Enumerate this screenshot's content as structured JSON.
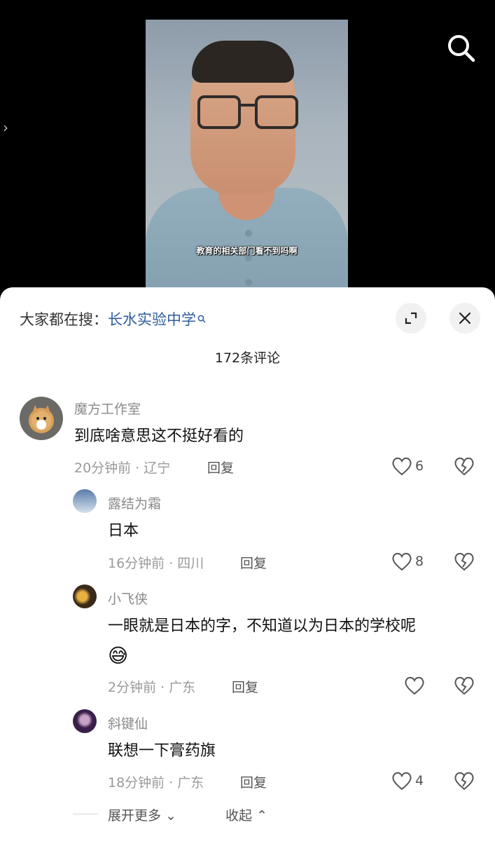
{
  "video": {
    "subtitle": "教育的相关部门看不到吗啊"
  },
  "sheet": {
    "hot_search_prefix": "大家都在搜：",
    "hot_search_keyword": "长水实验中学",
    "comment_count": "172条评论",
    "comments": [
      {
        "name": "魔方工作室",
        "text": "到底啥意思这不挺好看的",
        "time_loc": "20分钟前 · 辽宁",
        "reply": "回复",
        "likes": "6"
      },
      {
        "name": "露结为霜",
        "text": "日本",
        "time_loc": "16分钟前 · 四川",
        "reply": "回复",
        "likes": "8"
      },
      {
        "name": "小飞侠",
        "text": "一眼就是日本的字，不知道以为日本的学校呢",
        "emoji": "😅",
        "time_loc": "2分钟前 · 广东",
        "reply": "回复",
        "likes": ""
      },
      {
        "name": "斜键仙",
        "text": "联想一下膏药旗",
        "time_loc": "18分钟前 · 广东",
        "reply": "回复",
        "likes": "4"
      }
    ],
    "expand_more": "展开更多",
    "collapse": "收起"
  }
}
